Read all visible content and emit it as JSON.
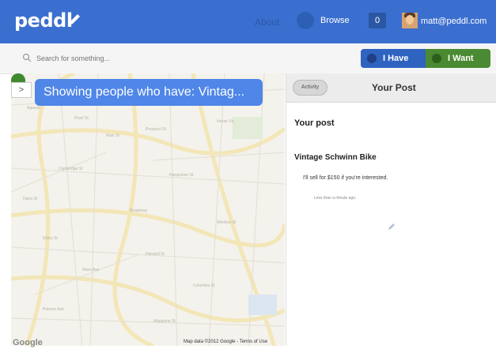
{
  "header": {
    "logo": "peddl",
    "nav_about": "About",
    "nav_browse": "Browse",
    "notifications_count": "0",
    "user_email": "matt@peddl.com"
  },
  "search": {
    "placeholder": "Search for something..."
  },
  "mode_buttons": {
    "have_label": "I Have",
    "want_label": "I Want"
  },
  "map": {
    "banner_text": "Showing people who have: Vintag...",
    "toggle_label": ">",
    "google_logo": "Google",
    "attribution": "Map data ©2012 Google - Terms of Use"
  },
  "panel": {
    "activity_label": "Activity",
    "title": "Your Post",
    "section_heading": "Your post",
    "post_title": "Vintage Schwinn Bike",
    "post_body": "I'll sell for $150 if you're interested.",
    "post_time": "Less than a minute ago."
  },
  "colors": {
    "header_bg": "#3b6fcf",
    "have_button": "#2f63c0",
    "want_button": "#4a8a32",
    "banner": "#4f86e8",
    "pin_blue": "#2f5fc4",
    "pin_green": "#3f8a2e"
  }
}
